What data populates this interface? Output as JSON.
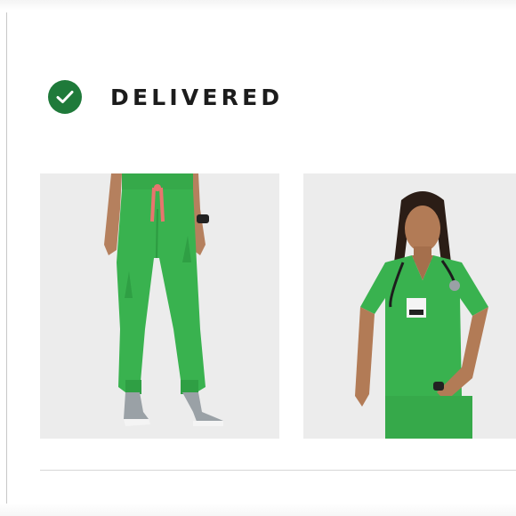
{
  "order": {
    "status_label": "DELIVERED",
    "status_icon": "check-circle-icon",
    "status_color": "#1f7a3a"
  },
  "items": [
    {
      "name_label": "",
      "image_description": "green-jogger-scrub-pants-image",
      "color": "#39b24f"
    },
    {
      "name_label": "",
      "image_description": "green-v-neck-scrub-top-image",
      "color": "#39b24f"
    }
  ],
  "colors": {
    "accent_green": "#1f7a3a",
    "scrub_green": "#39b24f",
    "drawstring": "#e8756e",
    "image_background": "#ececec"
  }
}
